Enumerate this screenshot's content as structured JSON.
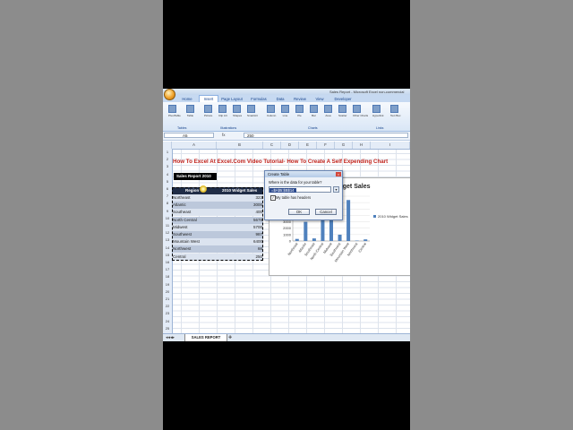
{
  "window": {
    "title": "Sales Report - Microsoft Excel non-commercial"
  },
  "tabs": [
    "Home",
    "Insert",
    "Page Layout",
    "Formulas",
    "Data",
    "Review",
    "View",
    "Developer"
  ],
  "active_tab": "Insert",
  "ribbon": {
    "buttons": [
      "PivotTable",
      "Table",
      "Picture",
      "Clip Art",
      "Shapes",
      "SmartArt",
      "Column",
      "Line",
      "Pie",
      "Bar",
      "Area",
      "Scatter",
      "Other Charts",
      "Hyperlink",
      "Text Box"
    ],
    "groups": [
      "Tables",
      "Illustrations",
      "Charts",
      "Links"
    ]
  },
  "formula_bar": {
    "name_box": "A5",
    "fx": "fx",
    "value": "250"
  },
  "columns": [
    "A",
    "B",
    "C",
    "D",
    "E",
    "F",
    "G",
    "H",
    "I"
  ],
  "rows": [
    "1",
    "2",
    "3",
    "4",
    "5",
    "6",
    "7",
    "8",
    "9",
    "10",
    "11",
    "12",
    "13",
    "14",
    "15",
    "16",
    "17",
    "18",
    "19",
    "20",
    "21",
    "22",
    "23",
    "24",
    "25",
    "26",
    "27",
    "28",
    "29",
    "30",
    "31"
  ],
  "headline": "How To Excel At Excel.Com Video Tutorial- How To Create A Self Expending Chart",
  "sales_report_label": "Sales Report 2010",
  "table": {
    "headers": [
      "Region",
      "2010 Widget Sales"
    ],
    "rows": [
      [
        "Northeast",
        "323"
      ],
      [
        "Atlantic",
        "3000"
      ],
      [
        "Southeast",
        "400"
      ],
      [
        "North Central",
        "5678"
      ],
      [
        "Midwest",
        "5700"
      ],
      [
        "Southwest",
        "987"
      ],
      [
        "Mountain West",
        "6400"
      ],
      [
        "Northwest",
        "66"
      ],
      [
        "Central",
        "250"
      ]
    ]
  },
  "dialog": {
    "title": "Create Table",
    "prompt": "Where is the data for your table?",
    "range": "=$A$5:$B$14",
    "checkbox_label": "My table has headers",
    "checkbox_checked": true,
    "ok_label": "OK",
    "cancel_label": "Cancel"
  },
  "chart_data": {
    "type": "bar",
    "title": "2010 Widget Sales",
    "categories": [
      "Northeast",
      "Atlantic",
      "Southeast",
      "North Central",
      "Midwest",
      "Southwest",
      "Mountain West",
      "Northwest",
      "Central"
    ],
    "series": [
      {
        "name": "2010 Widget Sales",
        "values": [
          323,
          3000,
          400,
          5678,
          5700,
          987,
          6400,
          66,
          250
        ]
      }
    ],
    "y_ticks": [
      "7000",
      "6000",
      "5000",
      "4000",
      "3000",
      "2000",
      "1000",
      "0"
    ],
    "ylim": [
      0,
      7000
    ],
    "legend_position": "right",
    "color": "#4f81bd"
  },
  "sheet_tab": "SALES REPORT"
}
